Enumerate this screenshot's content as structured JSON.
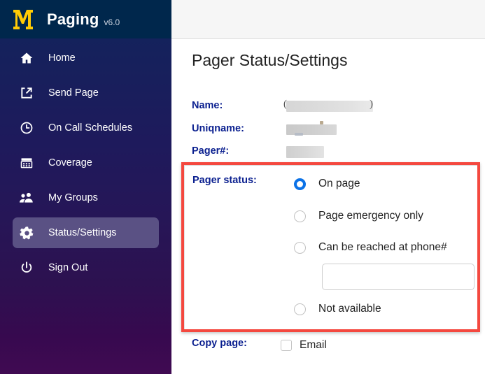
{
  "brand": {
    "logo_icon": "michigan-m-logo",
    "title": "Paging",
    "version": "v6.0"
  },
  "sidebar": {
    "items": [
      {
        "label": "Home",
        "icon": "home-icon",
        "key": "home",
        "active": false
      },
      {
        "label": "Send Page",
        "icon": "external-link-icon",
        "key": "send-page",
        "active": false
      },
      {
        "label": "On Call Schedules",
        "icon": "clock-icon",
        "key": "on-call-schedules",
        "active": false
      },
      {
        "label": "Coverage",
        "icon": "calendar-icon",
        "key": "coverage",
        "active": false
      },
      {
        "label": "My Groups",
        "icon": "people-icon",
        "key": "my-groups",
        "active": false
      },
      {
        "label": "Status/Settings",
        "icon": "gear-icon",
        "key": "status-settings",
        "active": true
      },
      {
        "label": "Sign Out",
        "icon": "power-icon",
        "key": "sign-out",
        "active": false
      }
    ]
  },
  "main": {
    "page_title": "Pager Status/Settings",
    "fields": {
      "name_label": "Name:",
      "name_value": "",
      "name_paren_open": "(",
      "name_paren_close": ")",
      "uniqname_label": "Uniqname:",
      "uniqname_value": "",
      "pager_label": "Pager#:",
      "pager_value": ""
    },
    "pager_status": {
      "label": "Pager status:",
      "selected": "on-page",
      "options": [
        {
          "key": "on-page",
          "label": "On page",
          "checked": true
        },
        {
          "key": "page-emergency-only",
          "label": "Page emergency only",
          "checked": false
        },
        {
          "key": "can-be-reached-at-phone",
          "label": "Can be reached at phone#",
          "checked": false
        },
        {
          "key": "not-available",
          "label": "Not available",
          "checked": false
        }
      ],
      "phone_input_value": "",
      "phone_input_placeholder": ""
    },
    "copy_page": {
      "label": "Copy page:",
      "email_label": "Email",
      "email_checked": false
    }
  },
  "colors": {
    "brand_navy": "#00274C",
    "brand_maize": "#FFCB05",
    "label_blue": "#0a1f8f",
    "radio_selected": "#0b72e7",
    "highlight_border": "#f4483f",
    "sidebar_active": "#5a5184"
  }
}
